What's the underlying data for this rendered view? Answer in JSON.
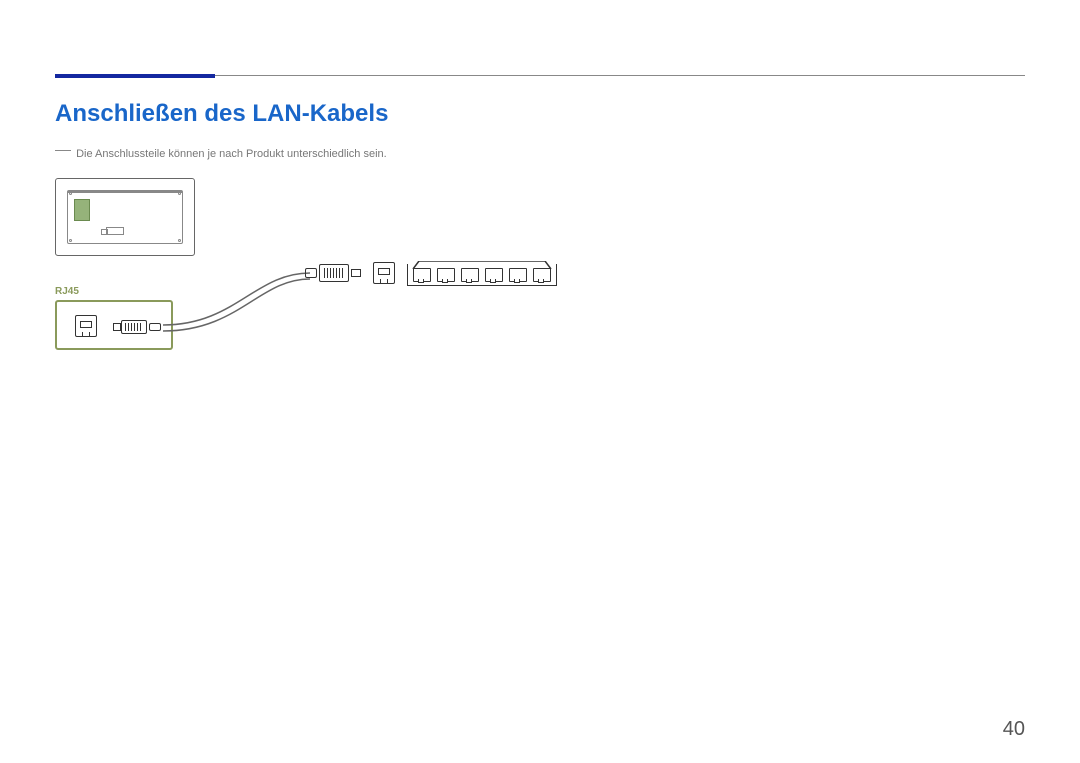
{
  "header": {
    "title": "Anschließen des LAN-Kabels"
  },
  "note": {
    "text": "Die Anschlussteile können je nach Produkt unterschiedlich sein."
  },
  "labels": {
    "port": "RJ45"
  },
  "page": {
    "number": "40"
  }
}
